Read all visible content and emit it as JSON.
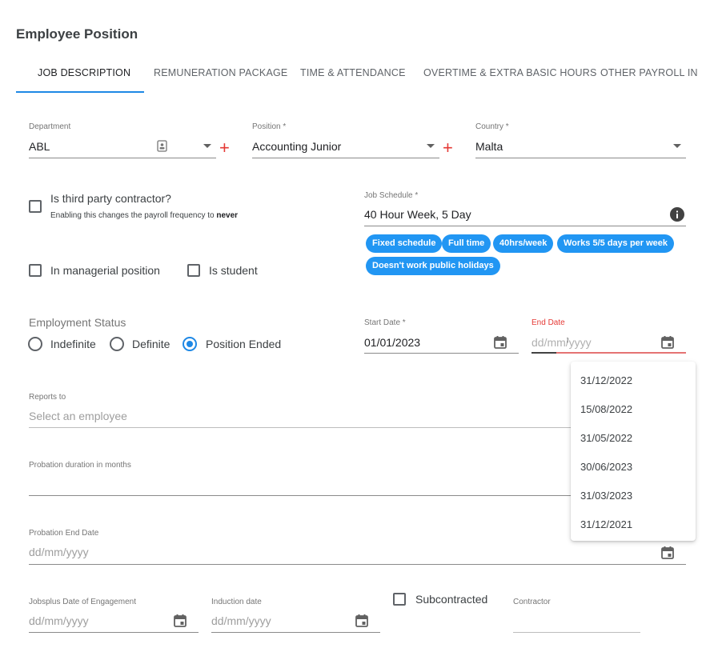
{
  "page": {
    "title": "Employee Position"
  },
  "tabs": [
    {
      "label": "JOB DESCRIPTION"
    },
    {
      "label": "REMUNERATION PACKAGE"
    },
    {
      "label": "TIME & ATTENDANCE"
    },
    {
      "label": "OVERTIME & EXTRA BASIC HOURS"
    },
    {
      "label": "OTHER PAYROLL INFO"
    }
  ],
  "department": {
    "label": "Department",
    "value": "ABL"
  },
  "position": {
    "label": "Position *",
    "value": "Accounting Junior"
  },
  "country": {
    "label": "Country *",
    "value": "Malta"
  },
  "third_party": {
    "label": "Is third party contractor?",
    "note_prefix": "Enabling this changes the payroll frequency to",
    "note_bold": "never",
    "checked": false
  },
  "job_schedule": {
    "label": "Job Schedule *",
    "value": "40 Hour Week, 5 Day",
    "chips": [
      "Fixed schedule",
      "Full time",
      "40hrs/week",
      "Works 5/5 days per week",
      "Doesn't work public holidays"
    ]
  },
  "managerial": {
    "label": "In managerial position",
    "checked": false
  },
  "student": {
    "label": "Is student",
    "checked": false
  },
  "employment_status": {
    "title": "Employment Status",
    "options": [
      "Indefinite",
      "Definite",
      "Position Ended"
    ],
    "selected": "Position Ended"
  },
  "start_date": {
    "label": "Start Date *",
    "value": "01/01/2023"
  },
  "end_date": {
    "label": "End Date",
    "placeholder": "dd/mm/yyyy"
  },
  "end_date_suggestions": [
    "31/12/2022",
    "15/08/2022",
    "31/05/2022",
    "30/06/2023",
    "31/03/2023",
    "31/12/2021"
  ],
  "reports_to": {
    "label": "Reports to",
    "placeholder": "Select an employee"
  },
  "probation_duration": {
    "label": "Probation duration in months",
    "value": ""
  },
  "probation_end": {
    "label": "Probation End Date",
    "placeholder": "dd/mm/yyyy"
  },
  "jobsplus": {
    "label": "Jobsplus Date of Engagement",
    "placeholder": "dd/mm/yyyy"
  },
  "induction": {
    "label": "Induction date",
    "placeholder": "dd/mm/yyyy"
  },
  "subcontracted": {
    "label": "Subcontracted",
    "checked": false
  },
  "contractor": {
    "label": "Contractor",
    "value": ""
  },
  "colors": {
    "accent": "#1e88e5",
    "chip": "#2196f3",
    "error": "#e53935",
    "plus": "#e53935"
  },
  "icons": [
    "contact-card-icon",
    "chevron-down-icon",
    "plus-icon",
    "info-icon",
    "calendar-icon",
    "text-cursor-icon"
  ]
}
